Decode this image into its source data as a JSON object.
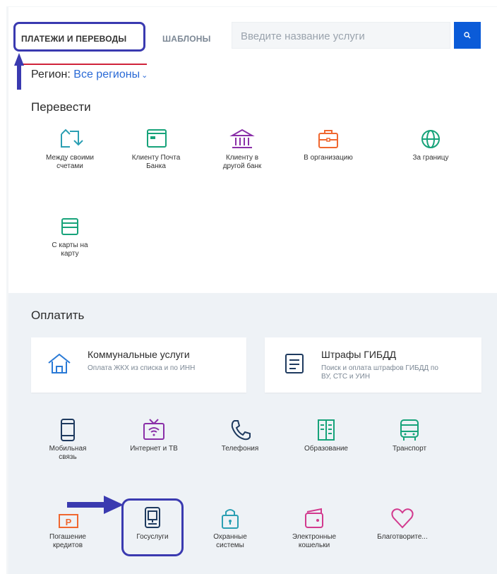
{
  "tabs": {
    "active": "ПЛАТЕЖИ И ПЕРЕВОДЫ",
    "inactive": "ШАБЛОНЫ"
  },
  "search": {
    "placeholder": "Введите название услуги"
  },
  "region": {
    "label": "Регион:",
    "value": "Все регионы"
  },
  "transfer": {
    "title": "Перевести",
    "items": [
      {
        "line1": "Между своими",
        "line2": "счетами",
        "icon": "arrows-swap-icon"
      },
      {
        "line1": "Клиенту Почта",
        "line2": "Банка",
        "icon": "card-icon"
      },
      {
        "line1": "Клиенту в",
        "line2": "другой банк",
        "icon": "bank-icon"
      },
      {
        "line1": "В организацию",
        "line2": "",
        "icon": "briefcase-icon"
      },
      {
        "line1": "За границу",
        "line2": "",
        "icon": "globe-icon"
      },
      {
        "line1": "С карты на",
        "line2": "карту",
        "icon": "cards-icon"
      }
    ]
  },
  "pay": {
    "title": "Оплатить",
    "cards": [
      {
        "title": "Коммунальные услуги",
        "sub1": "Оплата ЖКХ из списка и по ИНН",
        "sub2": "",
        "icon": "house-icon"
      },
      {
        "title": "Штрафы ГИБДД",
        "sub1": "Поиск и оплата штрафов ГИБДД по",
        "sub2": "ВУ, СТС и УИН",
        "icon": "document-icon"
      }
    ],
    "items": [
      {
        "line1": "Мобильная",
        "line2": "связь",
        "icon": "phone-icon"
      },
      {
        "line1": "Интернет и ТВ",
        "line2": "",
        "icon": "tv-icon"
      },
      {
        "line1": "Телефония",
        "line2": "",
        "icon": "handset-icon"
      },
      {
        "line1": "Образование",
        "line2": "",
        "icon": "book-icon"
      },
      {
        "line1": "Транспорт",
        "line2": "",
        "icon": "bus-icon"
      },
      {
        "line1": "Погашение",
        "line2": "кредитов",
        "icon": "credit-icon"
      },
      {
        "line1": "Госуслуги",
        "line2": "",
        "icon": "gosuslugi-icon"
      },
      {
        "line1": "Охранные",
        "line2": "системы",
        "icon": "lock-icon"
      },
      {
        "line1": "Электронные",
        "line2": "кошельки",
        "icon": "wallet-icon"
      },
      {
        "line1": "Благотворите...",
        "line2": "",
        "icon": "heart-icon"
      }
    ]
  },
  "colors": {
    "accent": "#0b5bd8",
    "teal": "#2b9fb3",
    "green": "#17a37a",
    "purple": "#8a2fa8",
    "orange": "#f0672f",
    "pink": "#d23a8e",
    "highlight": "#3a3ab0",
    "underline": "#d0233b"
  }
}
